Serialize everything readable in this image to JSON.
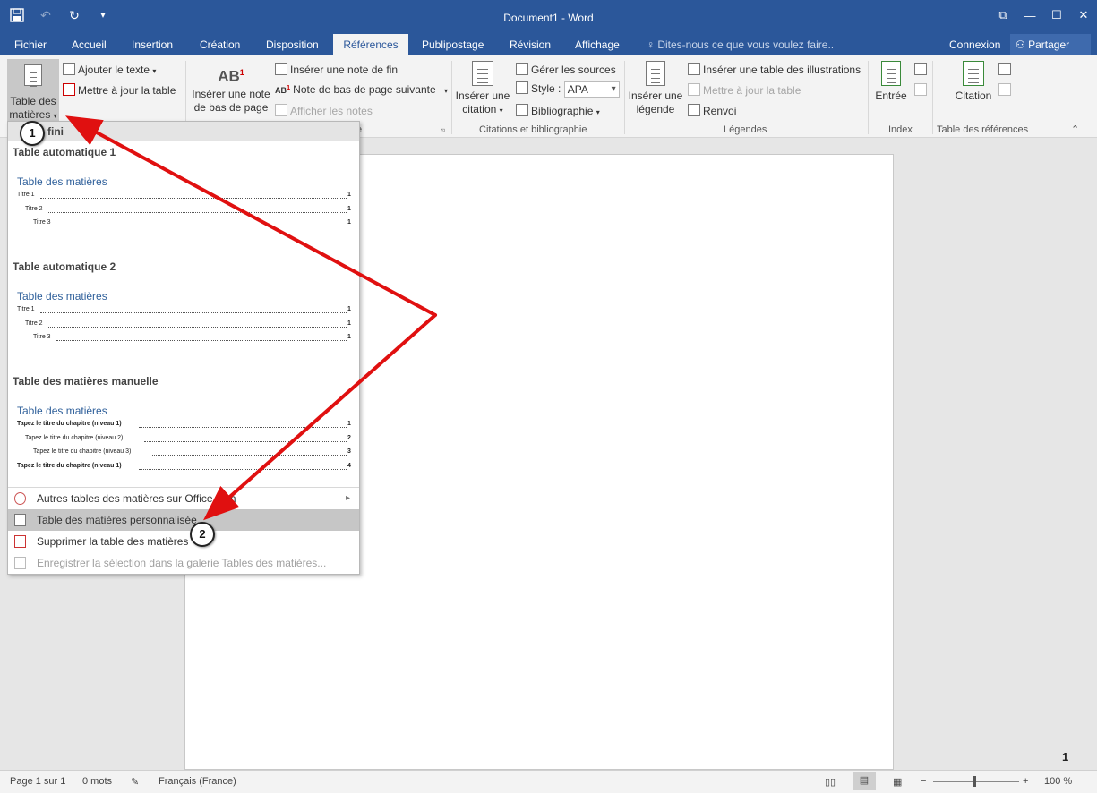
{
  "window": {
    "title": "Document1 - Word",
    "controls": [
      "restore-ribbon",
      "minimize",
      "maximize",
      "close"
    ]
  },
  "qat": [
    "save-icon",
    "undo-icon",
    "redo-icon",
    "customize-icon"
  ],
  "tabs": [
    {
      "label": "Fichier"
    },
    {
      "label": "Accueil"
    },
    {
      "label": "Insertion"
    },
    {
      "label": "Création"
    },
    {
      "label": "Disposition"
    },
    {
      "label": "Références",
      "active": true
    },
    {
      "label": "Publipostage"
    },
    {
      "label": "Révision"
    },
    {
      "label": "Affichage"
    }
  ],
  "tell_me": "Dites-nous ce que vous voulez faire..",
  "account": {
    "connexion": "Connexion",
    "partager": "Partager"
  },
  "ribbon": {
    "toc": {
      "table_des": "Table des",
      "matieres": "matières",
      "ajouter_texte": "Ajouter le texte",
      "mettre_a_jour": "Mettre à jour la table"
    },
    "footnotes": {
      "inserer_note_1": "Insérer une note",
      "inserer_note_2": "de bas de page",
      "note_fin": "Insérer une note de fin",
      "note_suivante": "Note de bas de page suivante",
      "afficher_notes": "Afficher les notes",
      "group_label_tail": "e"
    },
    "citations": {
      "inserer_citation_1": "Insérer une",
      "inserer_citation_2": "citation",
      "gerer_sources": "Gérer les sources",
      "style_label": "Style :",
      "style_value": "APA",
      "bibliographie": "Bibliographie",
      "group_label": "Citations et bibliographie"
    },
    "captions": {
      "inserer_legende_1": "Insérer une",
      "inserer_legende_2": "légende",
      "inserer_table_illustrations": "Insérer une table des illustrations",
      "mettre_a_jour_table": "Mettre à jour la table",
      "renvoi": "Renvoi",
      "group_label": "Légendes"
    },
    "index": {
      "entree": "Entrée",
      "group_label": "Index"
    },
    "authorities": {
      "citation": "Citation",
      "group_label": "Table des références"
    }
  },
  "dropdown": {
    "category": "Prédéfini",
    "category_visible": "fini",
    "auto1": {
      "heading": "Table automatique 1",
      "title": "Table des matières",
      "lines": [
        {
          "text": "Titre 1",
          "page": "1"
        },
        {
          "text": "Titre 2",
          "page": "1"
        },
        {
          "text": "Titre 3",
          "page": "1"
        }
      ]
    },
    "auto2": {
      "heading": "Table automatique 2",
      "title": "Table des matières",
      "lines": [
        {
          "text": "Titre 1",
          "page": "1"
        },
        {
          "text": "Titre 2",
          "page": "1"
        },
        {
          "text": "Titre 3",
          "page": "1"
        }
      ]
    },
    "manual": {
      "heading": "Table des matières manuelle",
      "title": "Table des matières",
      "lines": [
        {
          "text": "Tapez le titre du chapitre (niveau 1)",
          "page": "1"
        },
        {
          "text": "Tapez le titre du chapitre (niveau 2)",
          "page": "2"
        },
        {
          "text": "Tapez le titre du chapitre (niveau 3)",
          "page": "3"
        },
        {
          "text": "Tapez le titre du chapitre (niveau 1)",
          "page": "4"
        }
      ]
    },
    "items": [
      {
        "label": "Autres tables des matières sur Office.com"
      },
      {
        "label": "Table des matières personnalisée..."
      },
      {
        "label": "Supprimer la table des matières"
      },
      {
        "label": "Enregistrer la sélection dans la galerie Tables des matières..."
      }
    ]
  },
  "annotations": {
    "badge1": "1",
    "badge2": "2",
    "arrow_color": "#e01010"
  },
  "document": {
    "page_number": "1"
  },
  "statusbar": {
    "page": "Page 1 sur 1",
    "words": "0 mots",
    "language": "Français (France)",
    "zoom": "100 %"
  },
  "colors": {
    "title_bar": "#2b579a",
    "ribbon_bg": "#f3f3f3",
    "toc_title": "#2e5f9a"
  }
}
